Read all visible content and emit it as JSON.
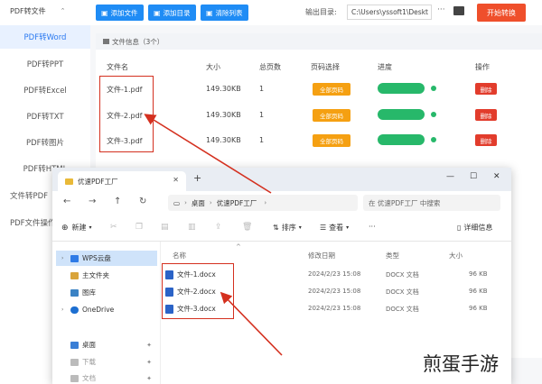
{
  "app": {
    "sidebar": {
      "top_label": "PDF转文件",
      "items": [
        "PDF转Word",
        "PDF转PPT",
        "PDF转Excel",
        "PDF转TXT",
        "PDF转图片",
        "PDF转HTML",
        "文件转PDF",
        "PDF文件操作"
      ]
    },
    "toolbar": {
      "add_file": "添加文件",
      "add_dir": "添加目录",
      "clear_list": "清除列表",
      "output_label": "输出目录:",
      "output_path": "C:\\Users\\yssoft1\\Deskt",
      "browse": "···",
      "start": "开始转换"
    },
    "file_info": "文件信息（3个）",
    "columns": [
      "文件名",
      "大小",
      "总页数",
      "页码选择",
      "进度",
      "操作"
    ],
    "files": [
      {
        "name": "文件-1.pdf",
        "size": "149.30KB",
        "pages": "1",
        "page_sel": "全部页码",
        "progress": 1.0,
        "action": "删除"
      },
      {
        "name": "文件-2.pdf",
        "size": "149.30KB",
        "pages": "1",
        "page_sel": "全部页码",
        "progress": 1.0,
        "action": "删除"
      },
      {
        "name": "文件-3.pdf",
        "size": "149.30KB",
        "pages": "1",
        "page_sel": "全部页码",
        "progress": 1.0,
        "action": "删除"
      }
    ]
  },
  "explorer": {
    "tab_title": "优速PDF工厂",
    "window_controls": [
      "—",
      "☐",
      "✕"
    ],
    "breadcrumb": [
      "桌面",
      "优速PDF工厂"
    ],
    "search_placeholder": "在 优速PDF工厂 中搜索",
    "commands": {
      "new": "新建",
      "sort": "排序",
      "view": "查看",
      "more": "···",
      "details": "详细信息"
    },
    "nav": [
      {
        "label": "WPS云盘",
        "selected": true
      },
      {
        "label": "主文件夹",
        "selected": false
      },
      {
        "label": "图库",
        "selected": false
      },
      {
        "label": "OneDrive",
        "selected": false
      },
      {
        "label": "桌面",
        "selected": false
      },
      {
        "label": "下载",
        "selected": false
      },
      {
        "label": "文档",
        "selected": false
      }
    ],
    "columns": [
      "名称",
      "修改日期",
      "类型",
      "大小"
    ],
    "files": [
      {
        "name": "文件-1.docx",
        "date": "2024/2/23 15:08",
        "type": "DOCX 文档",
        "size": "96 KB"
      },
      {
        "name": "文件-2.docx",
        "date": "2024/2/23 15:08",
        "type": "DOCX 文档",
        "size": "96 KB"
      },
      {
        "name": "文件-3.docx",
        "date": "2024/2/23 15:08",
        "type": "DOCX 文档",
        "size": "96 KB"
      }
    ]
  },
  "watermark": "煎蛋手游",
  "colors": {
    "primary": "#1f8cf5",
    "start": "#ef4f2b",
    "badge": "#f5a012",
    "progress": "#27b86a",
    "delete": "#e23c2c",
    "highlight": "#d4301f"
  }
}
